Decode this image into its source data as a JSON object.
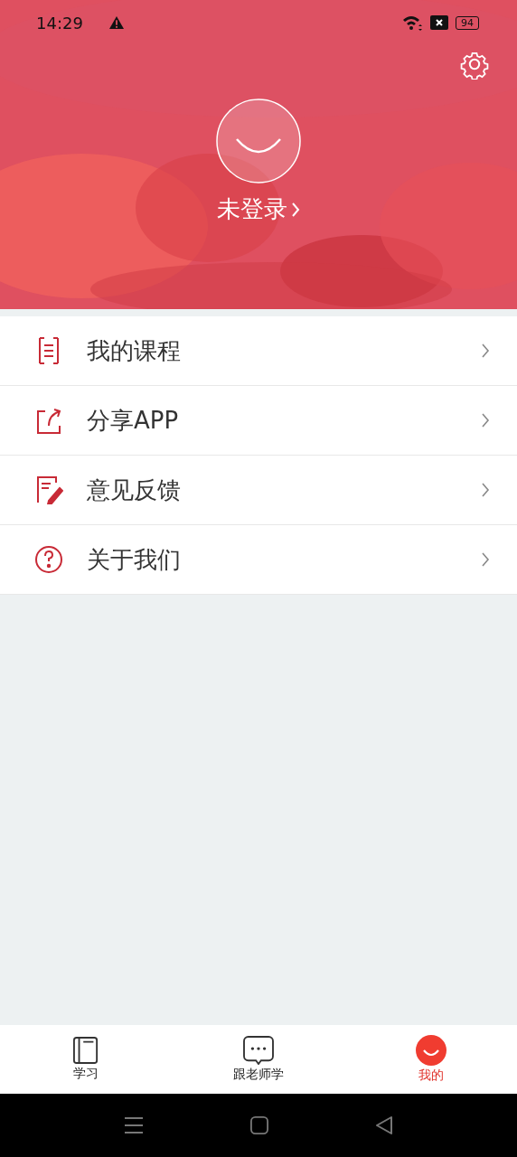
{
  "status_bar": {
    "time": "14:29",
    "battery": "94"
  },
  "profile": {
    "login_label": "未登录"
  },
  "menu": [
    {
      "label": "我的课程",
      "kind": "list"
    },
    {
      "label": "分享APP",
      "kind": "share"
    },
    {
      "label": "意见反馈",
      "kind": "edit"
    },
    {
      "label": "关于我们",
      "kind": "help"
    }
  ],
  "tabs": [
    {
      "label": "学习",
      "kind": "book",
      "selected": false
    },
    {
      "label": "跟老师学",
      "kind": "chat",
      "selected": false
    },
    {
      "label": "我的",
      "kind": "smile",
      "selected": true
    }
  ]
}
